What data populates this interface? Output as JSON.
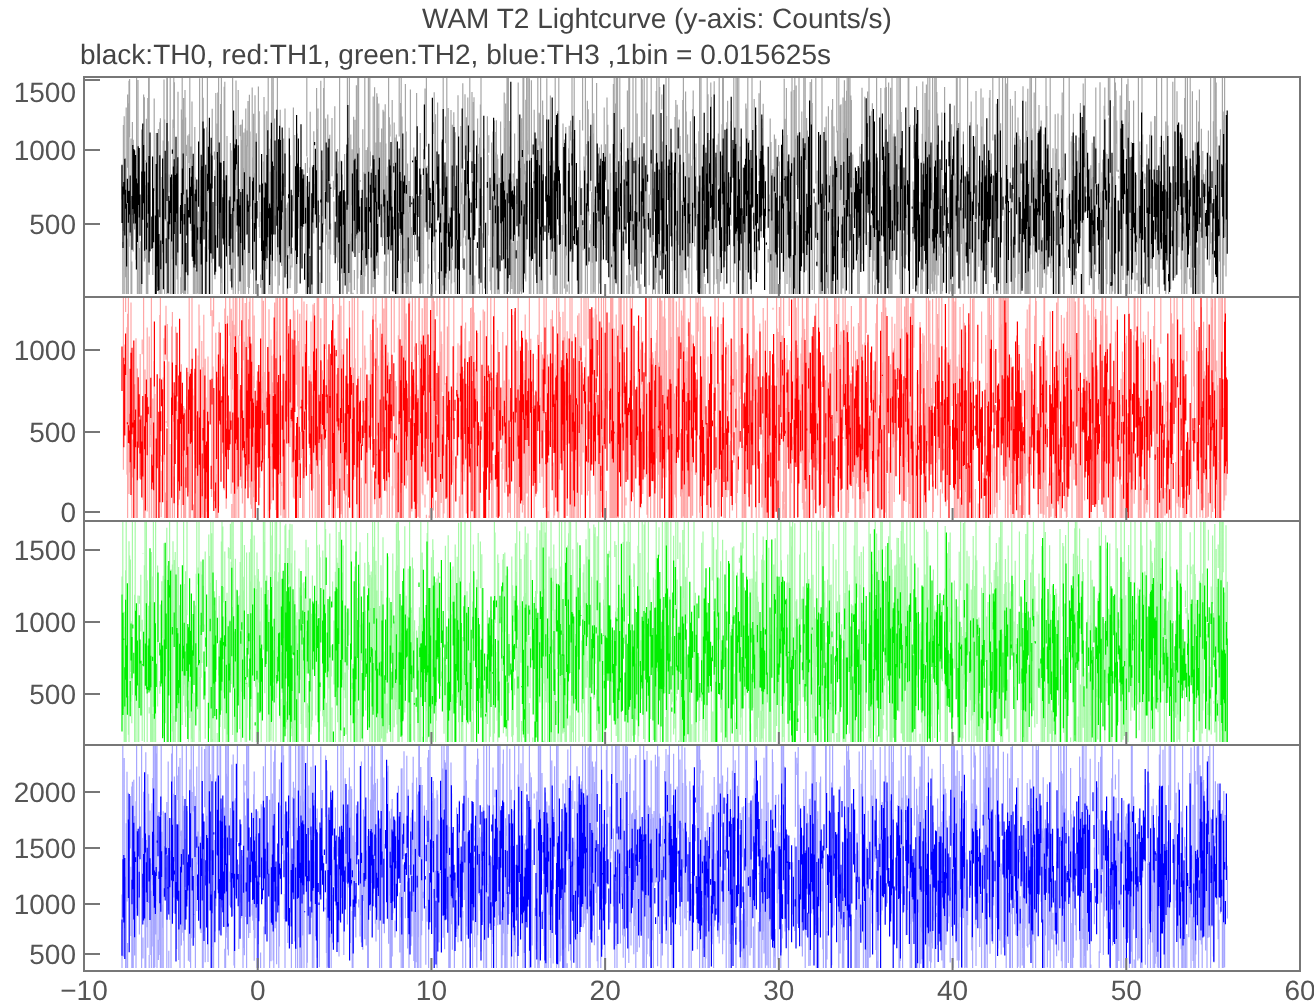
{
  "title": "WAM T2 Lightcurve (y-axis: Counts/s)",
  "legend": "black:TH0, red:TH1, green:TH2, blue:TH3 ,1bin = 0.015625s",
  "panels": [
    {
      "color": "#000000",
      "y_tick_labels": [
        "1500",
        "1000",
        "500"
      ]
    },
    {
      "color": "#ff0000",
      "y_tick_labels": [
        "1000",
        "500",
        "0"
      ]
    },
    {
      "color": "#00ee00",
      "y_tick_labels": [
        "1500",
        "1000",
        "500"
      ]
    },
    {
      "color": "#0000ff",
      "y_tick_labels": [
        "2000",
        "1500",
        "1000",
        "500"
      ]
    }
  ],
  "x_tick_labels": [
    "−10",
    "0",
    "10",
    "20",
    "30",
    "40",
    "50",
    "60"
  ]
}
